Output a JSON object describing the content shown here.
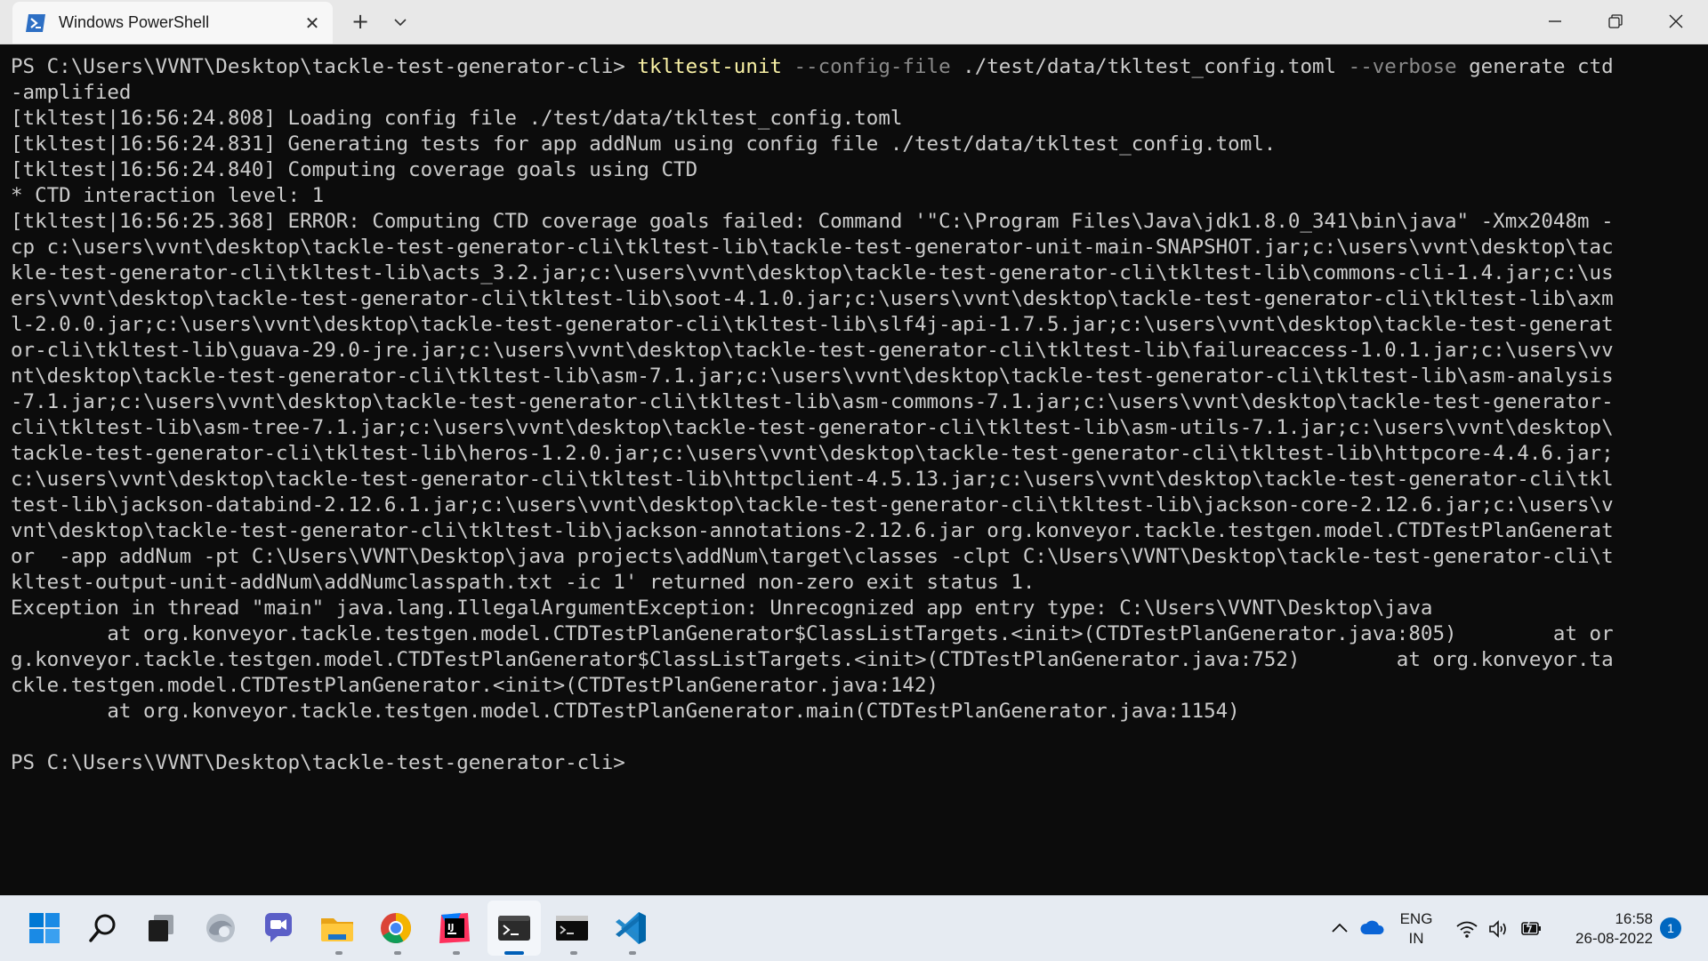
{
  "window": {
    "tab_title": "Windows PowerShell",
    "tab_close_glyph": "✕",
    "new_tab_glyph": "+",
    "icons": {
      "tab": "powershell-icon",
      "dropdown": "chevron-down-icon",
      "minimize": "minimize-icon",
      "maximize": "restore-icon",
      "close": "close-icon"
    }
  },
  "terminal": {
    "colors": {
      "background": "#0c0c0c",
      "foreground": "#cccccc",
      "command": "#f9f1a5",
      "parameter": "#8a8a8a"
    },
    "command": {
      "prompt": "PS C:\\Users\\VVNT\\Desktop\\tackle-test-generator-cli> ",
      "executable": "tkltest-unit",
      "flag_config": "--config-file",
      "config_path": " ./test/data/tkltest_config.toml ",
      "flag_verbose": "--verbose",
      "subcommand": " generate ctd",
      "continuation": "-amplified"
    },
    "output_lines": [
      "[tkltest|16:56:24.808] Loading config file ./test/data/tkltest_config.toml",
      "[tkltest|16:56:24.831] Generating tests for app addNum using config file ./test/data/tkltest_config.toml.",
      "[tkltest|16:56:24.840] Computing coverage goals using CTD",
      "* CTD interaction level: 1",
      "[tkltest|16:56:25.368] ERROR: Computing CTD coverage goals failed: Command '\"C:\\Program Files\\Java\\jdk1.8.0_341\\bin\\java\" -Xmx2048m -",
      "cp c:\\users\\vvnt\\desktop\\tackle-test-generator-cli\\tkltest-lib\\tackle-test-generator-unit-main-SNAPSHOT.jar;c:\\users\\vvnt\\desktop\\tac",
      "kle-test-generator-cli\\tkltest-lib\\acts_3.2.jar;c:\\users\\vvnt\\desktop\\tackle-test-generator-cli\\tkltest-lib\\commons-cli-1.4.jar;c:\\us",
      "ers\\vvnt\\desktop\\tackle-test-generator-cli\\tkltest-lib\\soot-4.1.0.jar;c:\\users\\vvnt\\desktop\\tackle-test-generator-cli\\tkltest-lib\\axm",
      "l-2.0.0.jar;c:\\users\\vvnt\\desktop\\tackle-test-generator-cli\\tkltest-lib\\slf4j-api-1.7.5.jar;c:\\users\\vvnt\\desktop\\tackle-test-generat",
      "or-cli\\tkltest-lib\\guava-29.0-jre.jar;c:\\users\\vvnt\\desktop\\tackle-test-generator-cli\\tkltest-lib\\failureaccess-1.0.1.jar;c:\\users\\vv",
      "nt\\desktop\\tackle-test-generator-cli\\tkltest-lib\\asm-7.1.jar;c:\\users\\vvnt\\desktop\\tackle-test-generator-cli\\tkltest-lib\\asm-analysis",
      "-7.1.jar;c:\\users\\vvnt\\desktop\\tackle-test-generator-cli\\tkltest-lib\\asm-commons-7.1.jar;c:\\users\\vvnt\\desktop\\tackle-test-generator-",
      "cli\\tkltest-lib\\asm-tree-7.1.jar;c:\\users\\vvnt\\desktop\\tackle-test-generator-cli\\tkltest-lib\\asm-utils-7.1.jar;c:\\users\\vvnt\\desktop\\",
      "tackle-test-generator-cli\\tkltest-lib\\heros-1.2.0.jar;c:\\users\\vvnt\\desktop\\tackle-test-generator-cli\\tkltest-lib\\httpcore-4.4.6.jar;",
      "c:\\users\\vvnt\\desktop\\tackle-test-generator-cli\\tkltest-lib\\httpclient-4.5.13.jar;c:\\users\\vvnt\\desktop\\tackle-test-generator-cli\\tkl",
      "test-lib\\jackson-databind-2.12.6.1.jar;c:\\users\\vvnt\\desktop\\tackle-test-generator-cli\\tkltest-lib\\jackson-core-2.12.6.jar;c:\\users\\v",
      "vnt\\desktop\\tackle-test-generator-cli\\tkltest-lib\\jackson-annotations-2.12.6.jar org.konveyor.tackle.testgen.model.CTDTestPlanGenerat",
      "or  -app addNum -pt C:\\Users\\VVNT\\Desktop\\java projects\\addNum\\target\\classes -clpt C:\\Users\\VVNT\\Desktop\\tackle-test-generator-cli\\t",
      "kltest-output-unit-addNum\\addNumclasspath.txt -ic 1' returned non-zero exit status 1.",
      "Exception in thread \"main\" java.lang.IllegalArgumentException: Unrecognized app entry type: C:\\Users\\VVNT\\Desktop\\java",
      "        at org.konveyor.tackle.testgen.model.CTDTestPlanGenerator$ClassListTargets.<init>(CTDTestPlanGenerator.java:805)        at or",
      "g.konveyor.tackle.testgen.model.CTDTestPlanGenerator$ClassListTargets.<init>(CTDTestPlanGenerator.java:752)        at org.konveyor.ta",
      "ckle.testgen.model.CTDTestPlanGenerator.<init>(CTDTestPlanGenerator.java:142)",
      "        at org.konveyor.tackle.testgen.model.CTDTestPlanGenerator.main(CTDTestPlanGenerator.java:1154)",
      "",
      "PS C:\\Users\\VVNT\\Desktop\\tackle-test-generator-cli>"
    ]
  },
  "taskbar": {
    "apps": [
      {
        "name": "start-button",
        "icon": "windows-logo-icon"
      },
      {
        "name": "search-button",
        "icon": "search-icon"
      },
      {
        "name": "task-view-button",
        "icon": "task-view-icon"
      },
      {
        "name": "edge-button",
        "icon": "edge-icon"
      },
      {
        "name": "teams-chat-button",
        "icon": "chat-icon"
      },
      {
        "name": "file-explorer-button",
        "icon": "folder-icon"
      },
      {
        "name": "chrome-button",
        "icon": "chrome-icon"
      },
      {
        "name": "intellij-button",
        "icon": "intellij-icon"
      },
      {
        "name": "windows-terminal-button",
        "icon": "terminal-icon"
      },
      {
        "name": "command-prompt-button",
        "icon": "cmd-icon"
      },
      {
        "name": "vscode-button",
        "icon": "vscode-icon"
      }
    ],
    "tray": {
      "lang_top": "ENG",
      "lang_bottom": "IN",
      "time": "16:58",
      "date": "26-08-2022",
      "notification_count": "1",
      "icons": [
        "chevron-up-icon",
        "onedrive-icon",
        "wifi-icon",
        "volume-icon",
        "battery-icon"
      ]
    },
    "colors": {
      "background": "#e6ebf2",
      "active_indicator": "#005fb8"
    }
  }
}
